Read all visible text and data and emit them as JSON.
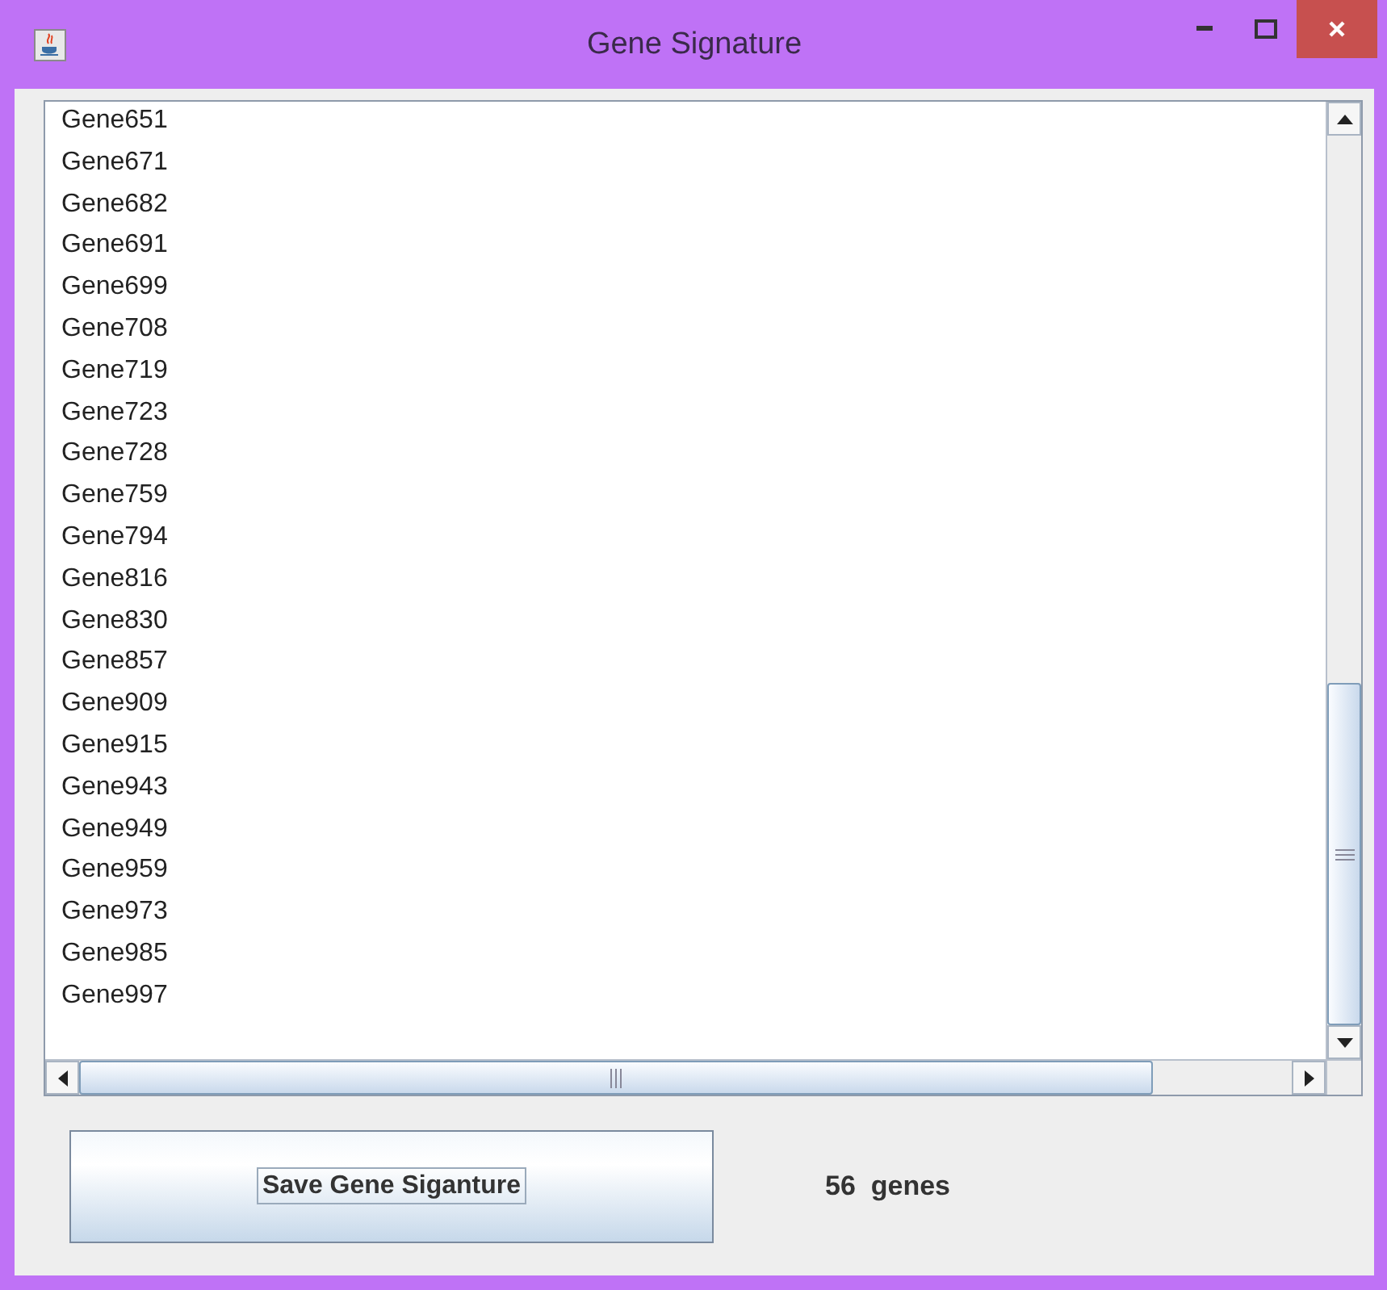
{
  "window": {
    "title": "Gene Signature"
  },
  "genes": [
    "Gene651",
    "Gene671",
    "Gene682",
    "Gene691",
    "Gene699",
    "Gene708",
    "Gene719",
    "Gene723",
    "Gene728",
    "Gene759",
    "Gene794",
    "Gene816",
    "Gene830",
    "Gene857",
    "Gene909",
    "Gene915",
    "Gene943",
    "Gene949",
    "Gene959",
    "Gene973",
    "Gene985",
    "Gene997"
  ],
  "save_button": {
    "label": "Save Gene Siganture"
  },
  "gene_count": "56  genes"
}
